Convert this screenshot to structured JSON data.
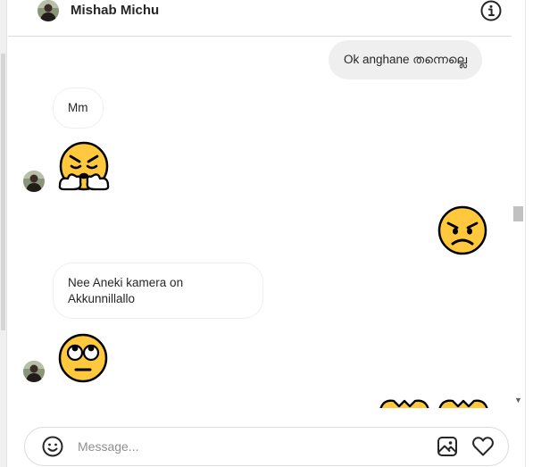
{
  "header": {
    "contact_name": "Mishab Michu",
    "avatar_icon": "profile-photo",
    "info_icon": "info-icon"
  },
  "messages": [
    {
      "type": "text",
      "direction": "outgoing",
      "text": "Ok anghane തന്നെല്ലെ"
    },
    {
      "type": "text",
      "direction": "incoming",
      "text": "Mm"
    },
    {
      "type": "emoji",
      "direction": "incoming",
      "emoji": "face-with-steam-from-nose"
    },
    {
      "type": "emoji",
      "direction": "outgoing",
      "emoji": "angry-face"
    },
    {
      "type": "text",
      "direction": "incoming",
      "text": "Nee Aneki kamera on Akkunnillallo"
    },
    {
      "type": "emoji",
      "direction": "incoming",
      "emoji": "face-with-rolling-eyes"
    },
    {
      "type": "emoji",
      "direction": "outgoing",
      "emoji": "partially-visible-emojis"
    }
  ],
  "composer": {
    "placeholder": "Message...",
    "emoji_icon": "smiley-icon",
    "image_icon": "image-icon",
    "like_icon": "heart-icon"
  },
  "colors": {
    "outgoing_bubble": "#efefef",
    "incoming_border": "#efefef",
    "emoji_yellow": "#ffc83d",
    "emoji_outline": "#000000"
  }
}
